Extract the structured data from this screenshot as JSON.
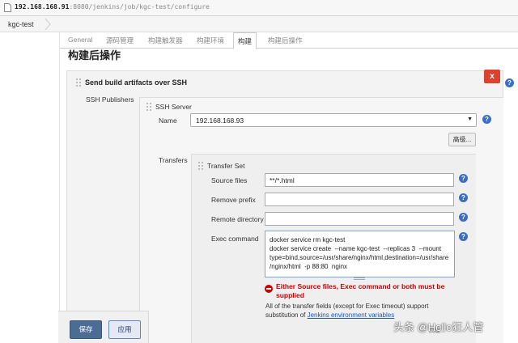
{
  "browser": {
    "url_host": "192.168.168.91",
    "url_rest": ":8080/jenkins/job/kgc-test/configure"
  },
  "breadcrumb": {
    "job": "kgc-test"
  },
  "tabs": [
    {
      "label": "General",
      "active": false
    },
    {
      "label": "源码管理",
      "active": false
    },
    {
      "label": "构建触发器",
      "active": false
    },
    {
      "label": "构建环境",
      "active": false
    },
    {
      "label": "构建",
      "active": true
    },
    {
      "label": "构建后操作",
      "active": false
    }
  ],
  "section": {
    "title": "构建后操作"
  },
  "step": {
    "title": "Send build artifacts over SSH",
    "delete_label": "x",
    "publishers_label": "SSH Publishers",
    "server": {
      "title": "SSH Server",
      "name_label": "Name",
      "name_value": "192.168.168.93",
      "advanced_label": "高级...",
      "transfers_label": "Transfers",
      "transfer_set": {
        "title": "Transfer Set",
        "source_files_label": "Source files",
        "source_files_value": "**/*.html",
        "remove_prefix_label": "Remove prefix",
        "remove_prefix_value": "",
        "remote_directory_label": "Remote directory",
        "remote_directory_value": "",
        "exec_command_label": "Exec command",
        "exec_command_value": "docker service rm kgc-test\ndocker service create  --name kgc-test  --replicas 3  --mount\ntype=bind,source=/usr/share/nginx/html,destination=/usr/share\n/nginx/html  -p 88:80  nginx",
        "error_message": "Either Source files, Exec command or both must be supplied",
        "note_prefix": "All of the transfer fields (except for Exec timeout) support substitution of",
        "note_link": "Jenkins environment variables"
      }
    }
  },
  "buttons": {
    "save": "保存",
    "apply": "应用"
  },
  "watermark": {
    "text": "头条 @Hello狂人管",
    "sub": "高级..."
  },
  "colors": {
    "delete_button": "#d9432f",
    "help_icon": "#3a6fc4",
    "error": "#cc0000",
    "save_button": "#4b6d94",
    "link": "#1f58b5"
  },
  "icons": [
    "page-icon",
    "breadcrumb-separator-icon",
    "drag-handle-icon",
    "help-icon",
    "error-icon",
    "chevron-down-icon"
  ]
}
